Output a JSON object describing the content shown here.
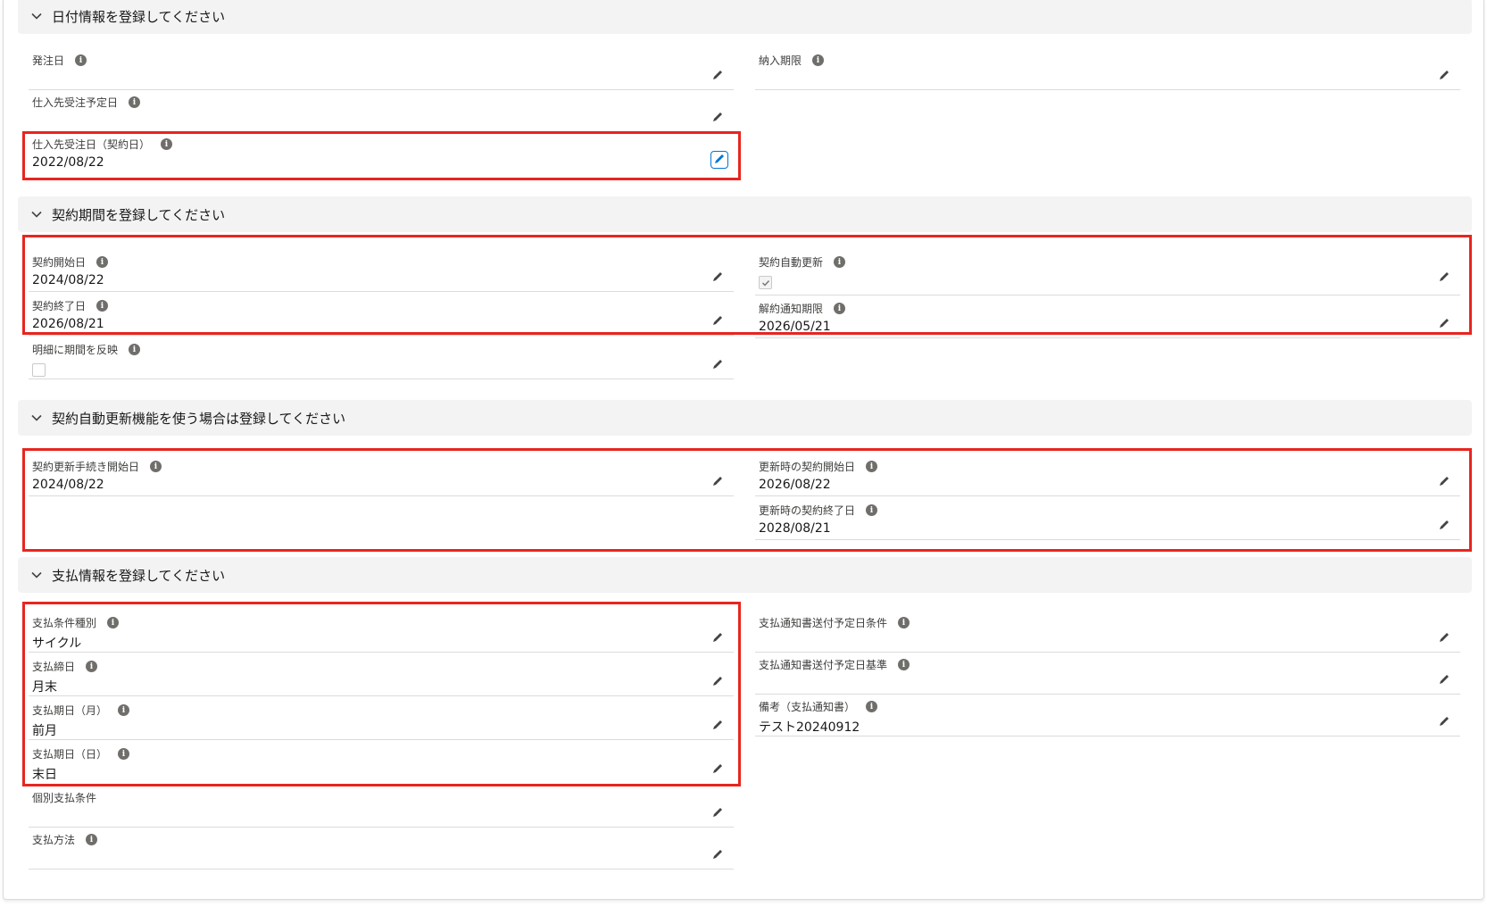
{
  "sections": {
    "date_info": {
      "title": "日付情報を登録してください",
      "order_date": {
        "label": "発注日",
        "value": ""
      },
      "delivery_deadline": {
        "label": "納入期限",
        "value": ""
      },
      "supplier_planned_date": {
        "label": "仕入先受注予定日",
        "value": ""
      },
      "supplier_contract_date": {
        "label": "仕入先受注日（契約日）",
        "value": "2022/08/22"
      }
    },
    "contract_period": {
      "title": "契約期間を登録してください",
      "start_date": {
        "label": "契約開始日",
        "value": "2024/08/22"
      },
      "auto_renew": {
        "label": "契約自動更新",
        "checked": true
      },
      "end_date": {
        "label": "契約終了日",
        "value": "2026/08/21"
      },
      "cancel_notice_deadline": {
        "label": "解約通知期限",
        "value": "2026/05/21"
      },
      "reflect_period": {
        "label": "明細に期間を反映",
        "checked": false
      }
    },
    "auto_renew_section": {
      "title": "契約自動更新機能を使う場合は登録してください",
      "renewal_proc_start": {
        "label": "契約更新手続き開始日",
        "value": "2024/08/22"
      },
      "renewal_start": {
        "label": "更新時の契約開始日",
        "value": "2026/08/22"
      },
      "renewal_end": {
        "label": "更新時の契約終了日",
        "value": "2028/08/21"
      }
    },
    "payment_info": {
      "title": "支払情報を登録してください",
      "payment_terms_type": {
        "label": "支払条件種別",
        "value": "サイクル"
      },
      "notice_send_condition": {
        "label": "支払通知書送付予定日条件",
        "value": ""
      },
      "closing_date": {
        "label": "支払締日",
        "value": "月末"
      },
      "notice_send_basis": {
        "label": "支払通知書送付予定日基準",
        "value": ""
      },
      "payment_month": {
        "label": "支払期日（月）",
        "value": "前月"
      },
      "remarks": {
        "label": "備考（支払通知書）",
        "value": "テスト20240912"
      },
      "payment_day": {
        "label": "支払期日（日）",
        "value": "末日"
      },
      "individual_terms": {
        "label": "個別支払条件",
        "value": ""
      },
      "payment_method": {
        "label": "支払方法",
        "value": ""
      }
    }
  },
  "colors": {
    "highlight": "#e8251f",
    "accent": "#0176d3",
    "section_bg": "#f3f3f3"
  },
  "icons": {
    "info": "info-icon",
    "edit": "pencil-icon",
    "collapse": "chevron-down-icon"
  }
}
